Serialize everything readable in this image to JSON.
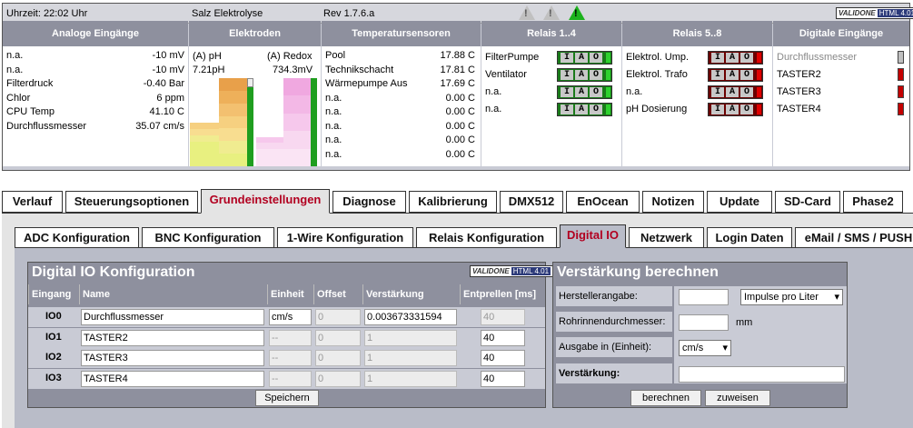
{
  "status": {
    "time": "Uhrzeit: 22:02 Uhr",
    "mode": "Salz Elektrolyse",
    "rev": "Rev 1.7.6.a",
    "validator": {
      "v1": "VALIDONE",
      "v2": "HTML 4.01"
    }
  },
  "analog": {
    "header": "Analoge Eingänge",
    "rows": [
      {
        "label": "n.a.",
        "value": "-10 mV"
      },
      {
        "label": "n.a.",
        "value": "-10 mV"
      },
      {
        "label": "Filterdruck",
        "value": "-0.40 Bar"
      },
      {
        "label": "Chlor",
        "value": "6 ppm"
      },
      {
        "label": "CPU Temp",
        "value": "41.10 C"
      },
      {
        "label": "Durchflussmesser",
        "value": "35.07 cm/s"
      }
    ]
  },
  "electrodes": {
    "header": "Elektroden",
    "ph_label": "(A) pH",
    "ph_value": "7.21pH",
    "redox_label": "(A) Redox",
    "redox_value": "734.3mV",
    "colors": {
      "ph": [
        "#e8a04a",
        "#eeb05a",
        "#f3c070",
        "#f6d080",
        "#f8dd90",
        "#f0ec90",
        "#e8f080"
      ],
      "redox": [
        "#f0a8e0",
        "#f3b8e6",
        "#f6c8ec",
        "#f8d8f0",
        "#fae4f4"
      ],
      "level": "#1f9e1f"
    }
  },
  "temps": {
    "header": "Temperatursensoren",
    "rows": [
      {
        "label": "Pool",
        "value": "17.88 C"
      },
      {
        "label": "Technikschacht",
        "value": "17.81 C"
      },
      {
        "label": "Wärmepumpe Aus",
        "value": "17.69 C"
      },
      {
        "label": "n.a.",
        "value": "0.00 C"
      },
      {
        "label": "n.a.",
        "value": "0.00 C"
      },
      {
        "label": "n.a.",
        "value": "0.00 C"
      },
      {
        "label": "n.a.",
        "value": "0.00 C"
      },
      {
        "label": "n.a.",
        "value": "0.00 C"
      }
    ]
  },
  "relais14": {
    "header": "Relais 1..4",
    "rows": [
      {
        "label": "FilterPumpe",
        "state": "on"
      },
      {
        "label": "Ventilator",
        "state": "on"
      },
      {
        "label": "n.a.",
        "state": "on"
      },
      {
        "label": "n.a.",
        "state": "on"
      }
    ]
  },
  "relais58": {
    "header": "Relais 5..8",
    "rows": [
      {
        "label": "Elektrol. Ump.",
        "state": "off"
      },
      {
        "label": "Elektrol. Trafo",
        "state": "off"
      },
      {
        "label": "n.a.",
        "state": "off"
      },
      {
        "label": "pH Dosierung",
        "state": "off"
      }
    ]
  },
  "iao": {
    "i": "I",
    "a": "A",
    "o": "O"
  },
  "digital_inputs": {
    "header": "Digitale Eingänge",
    "rows": [
      {
        "label": "Durchflussmesser",
        "active": false
      },
      {
        "label": "TASTER2",
        "active": true
      },
      {
        "label": "TASTER3",
        "active": true
      },
      {
        "label": "TASTER4",
        "active": true
      }
    ]
  },
  "tabs": [
    "Verlauf",
    "Steuerungsoptionen",
    "Grundeinstellungen",
    "Diagnose",
    "Kalibrierung",
    "DMX512",
    "EnOcean",
    "Notizen",
    "Update",
    "SD-Card",
    "Phase2"
  ],
  "active_tab": "Grundeinstellungen",
  "subtabs": [
    "ADC Konfiguration",
    "BNC Konfiguration",
    "1-Wire Konfiguration",
    "Relais Konfiguration",
    "Digital IO",
    "Netzwerk",
    "Login Daten",
    "eMail / SMS / PUSH"
  ],
  "active_subtab": "Digital IO",
  "dio": {
    "title": "Digital IO Konfiguration",
    "columns": [
      "Eingang",
      "Name",
      "Einheit",
      "Offset",
      "Verstärkung",
      "Entprellen [ms]"
    ],
    "rows": [
      {
        "id": "IO0",
        "name": "Durchflussmesser",
        "unit": "cm/s",
        "offset": "0",
        "gain": "0.003673331594",
        "debounce": "40"
      },
      {
        "id": "IO1",
        "name": "TASTER2",
        "unit": "--",
        "offset": "0",
        "gain": "1",
        "debounce": "40"
      },
      {
        "id": "IO2",
        "name": "TASTER3",
        "unit": "--",
        "offset": "0",
        "gain": "1",
        "debounce": "40"
      },
      {
        "id": "IO3",
        "name": "TASTER4",
        "unit": "--",
        "offset": "0",
        "gain": "1",
        "debounce": "40"
      }
    ],
    "save": "Speichern"
  },
  "calc": {
    "title": "Verstärkung berechnen",
    "manufacturer_label": "Herstellerangabe:",
    "manufacturer_value": "",
    "manufacturer_unit": "Impulse pro Liter",
    "pipe_label": "Rohrinnendurchmesser:",
    "pipe_value": "",
    "pipe_unit": "mm",
    "output_label": "Ausgabe in (Einheit):",
    "output_unit": "cm/s",
    "gain_label": "Verstärkung:",
    "gain_value": "",
    "calc_button": "berechnen",
    "assign_button": "zuweisen"
  }
}
